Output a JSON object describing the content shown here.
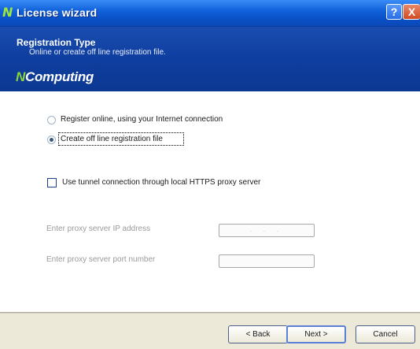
{
  "window": {
    "title": "License wizard",
    "help_glyph": "?",
    "close_glyph": "X",
    "icon": "ncomputing-n-icon"
  },
  "header": {
    "title": "Registration Type",
    "subtitle": "Online or create off line registration file.",
    "brand": {
      "n": "N",
      "rest": "Computing"
    }
  },
  "options": {
    "online_label": "Register online, using your Internet connection",
    "offline_label": "Create off line registration file",
    "selected": "offline"
  },
  "proxy": {
    "tunnel_label": "Use tunnel connection through local HTTPS proxy server",
    "tunnel_checked": false,
    "ip_label": "Enter proxy server IP address",
    "ip_value": ". . .",
    "port_label": "Enter proxy server port number",
    "port_value": ""
  },
  "buttons": {
    "back": "< Back",
    "next": "Next >",
    "cancel": "Cancel"
  }
}
